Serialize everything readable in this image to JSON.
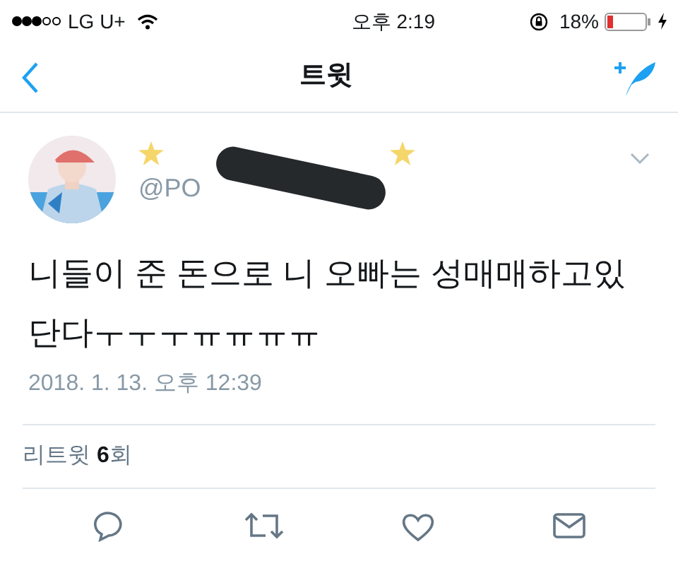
{
  "status_bar": {
    "carrier": "LG U+",
    "time": "오후 2:19",
    "battery_percent": "18%"
  },
  "nav": {
    "title": "트윗"
  },
  "tweet": {
    "handle": "@PO",
    "text": "니들이 준 돈으로 니 오빠는 성매매하고있단다ㅜㅜㅜㅠㅠㅠㅠ",
    "timestamp": "2018. 1. 13. 오후 12:39",
    "retweets": "리트윗 **6**회"
  }
}
